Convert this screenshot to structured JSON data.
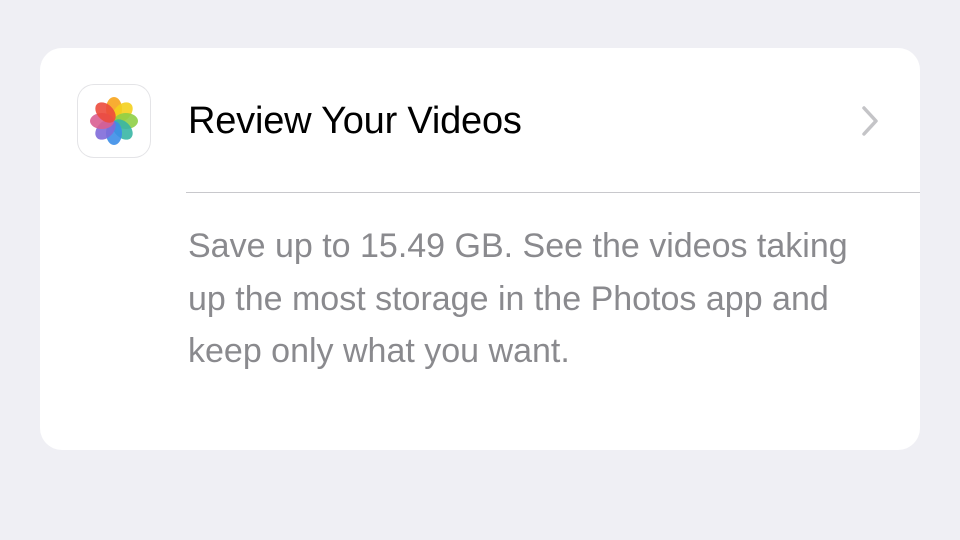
{
  "card": {
    "app_icon": "photos-app-icon",
    "title": "Review Your Videos",
    "chevron_icon": "chevron-right-icon",
    "description": "Save up to 15.49 GB. See the videos taking up the most storage in the Photos app and keep only what you want."
  },
  "colors": {
    "background": "#efeff4",
    "card": "#ffffff",
    "title_text": "#000000",
    "description_text": "#8a8a8e",
    "chevron": "#c4c4c7",
    "divider": "#c8c8cc"
  }
}
